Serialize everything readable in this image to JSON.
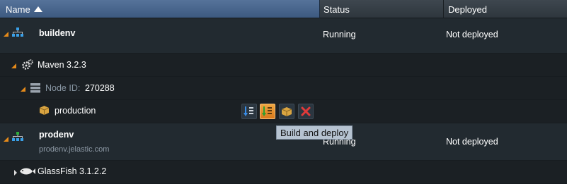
{
  "header": {
    "name_label": "Name",
    "status_label": "Status",
    "deployed_label": "Deployed"
  },
  "environments": [
    {
      "name": "buildenv",
      "status": "Running",
      "deployed": "Not deployed",
      "server": "Maven 3.2.3",
      "node_label": "Node ID:",
      "node_id": "270288",
      "project": "production"
    },
    {
      "name": "prodenv",
      "domain": "prodenv.jelastic.com",
      "status": "Running",
      "deployed": "Not deployed",
      "server": "GlassFish 3.1.2.2"
    }
  ],
  "tooltip": "Build and deploy",
  "actions": [
    "build-icon",
    "build-and-deploy-icon",
    "deploy-icon",
    "delete-icon"
  ],
  "colors": {
    "header_active": "#4a6790",
    "accent_orange": "#e58a1a",
    "delete_red": "#e03a3a"
  }
}
